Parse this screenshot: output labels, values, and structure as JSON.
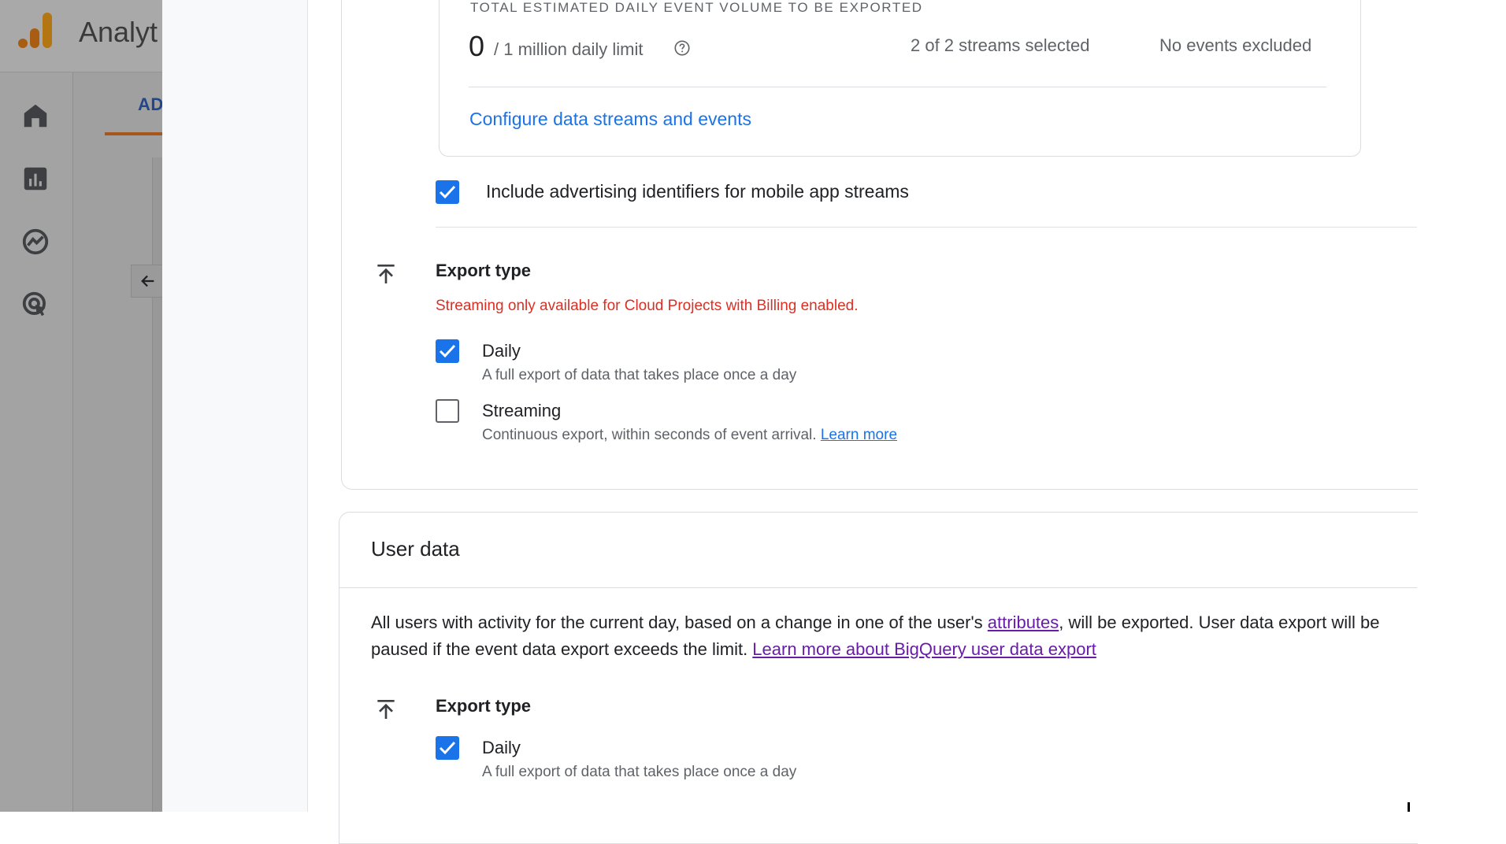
{
  "app": {
    "title": "Analyt",
    "admin_tab": "AD"
  },
  "nav_icons": [
    "home-icon",
    "reports-icon",
    "explore-icon",
    "advertising-icon"
  ],
  "event_data": {
    "volume_heading": "TOTAL ESTIMATED DAILY EVENT VOLUME TO BE EXPORTED",
    "volume_count": "0",
    "volume_limit": "/ 1 million daily limit",
    "streams_selected": "2 of 2 streams selected",
    "events_excluded": "No events excluded",
    "configure_link": "Configure data streams and events",
    "ad_identifiers": {
      "label": "Include advertising identifiers for mobile app streams",
      "checked": true
    },
    "export_type": {
      "label": "Export type",
      "warning": "Streaming only available for Cloud Projects with Billing enabled.",
      "daily": {
        "title": "Daily",
        "description": "A full export of data that takes place once a day",
        "checked": true
      },
      "streaming": {
        "title": "Streaming",
        "description": "Continuous export, within seconds of event arrival.",
        "link": "Learn more",
        "checked": false
      }
    }
  },
  "user_data": {
    "title": "User data",
    "desc_part1": "All users with activity for the current day, based on a change in one of the user's ",
    "desc_link1": "attributes",
    "desc_part2": ", will be exported. User data export will be paused if the event data export exceeds the limit. ",
    "desc_link2": "Learn more about BigQuery user data export",
    "export_type": {
      "label": "Export type",
      "daily": {
        "title": "Daily",
        "description": "A full export of data that takes place once a day",
        "checked": true
      }
    }
  },
  "colors": {
    "accent": "#1a73e8",
    "warning": "#d93025",
    "visited_link": "#681da8"
  }
}
